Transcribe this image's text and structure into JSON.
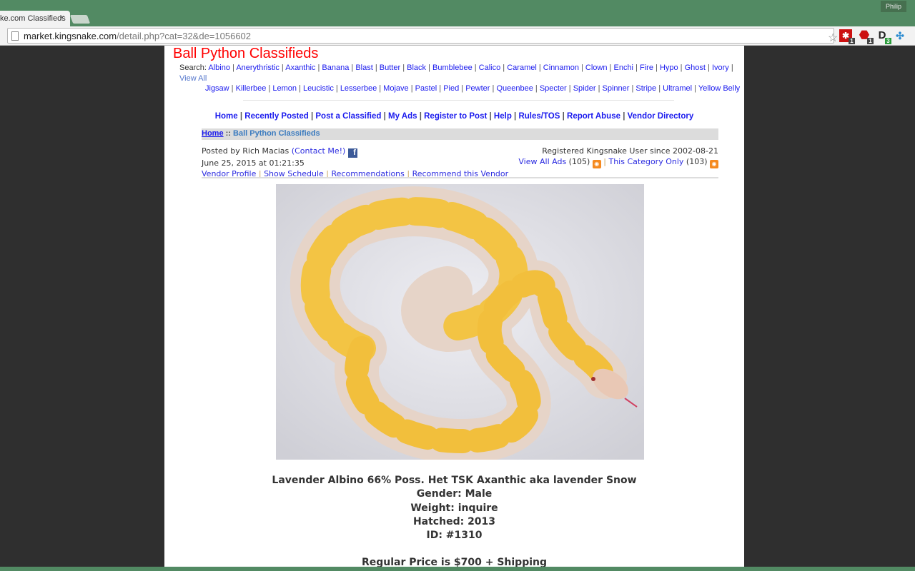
{
  "browser": {
    "tab_title": "ke.com Classifieds",
    "tab_close": "×",
    "profile": "Philip",
    "url_host": "market.kingsnake.com",
    "url_path": "/detail.php?cat=32&de=1056602",
    "bookmark_star": "☆",
    "extensions": [
      {
        "name": "lastpass",
        "badge": "1",
        "color": "#cc1111"
      },
      {
        "name": "adblock",
        "badge": "1",
        "color": "#cc1111"
      },
      {
        "name": "disconnect",
        "badge": "3",
        "color": "#222222"
      }
    ]
  },
  "site": {
    "title": "Ball Python Classifieds",
    "search_label": "Search:",
    "search_row1": [
      "Albino",
      "Anerythristic",
      "Axanthic",
      "Banana",
      "Blast",
      "Butter",
      "Black",
      "Bumblebee",
      "Calico",
      "Caramel",
      "Cinnamon",
      "Clown",
      "Enchi",
      "Fire",
      "Hypo",
      "Ghost",
      "Ivory"
    ],
    "view_all": "View All",
    "search_row2": [
      "Jigsaw",
      "Killerbee",
      "Lemon",
      "Leucistic",
      "Lesserbee",
      "Mojave",
      "Pastel",
      "Pied",
      "Pewter",
      "Queenbee",
      "Specter",
      "Spider",
      "Spinner",
      "Stripe",
      "Ultramel",
      "Yellow Belly"
    ],
    "nav": [
      "Home",
      "Recently Posted",
      "Post a Classified",
      "My Ads",
      "Register to Post",
      "Help",
      "Rules/TOS",
      "Report Abuse",
      "Vendor Directory"
    ],
    "breadcrumb": {
      "home": "Home",
      "sep": "::",
      "category": "Ball Python Classifieds"
    }
  },
  "listing": {
    "posted_by": "Posted by Rich Macias",
    "contact": "(Contact Me!)",
    "date": "June 25, 2015 at 01:21:35",
    "registered": "Registered Kingsnake User since 2002-08-21",
    "view_all_ads": "View All Ads",
    "view_all_count": "(105)",
    "category_only": "This Category Only",
    "category_count": "(103)",
    "vendor_links": [
      "Vendor Profile",
      "Show Schedule",
      "Recommendations",
      "Recommend this Vendor"
    ],
    "details": [
      "Lavender Albino 66% Poss. Het TSK Axanthic aka lavender Snow",
      "Gender: Male",
      "Weight: inquire",
      "Hatched: 2013",
      "ID: #1310",
      "",
      "Regular Price is $700 + Shipping"
    ]
  }
}
